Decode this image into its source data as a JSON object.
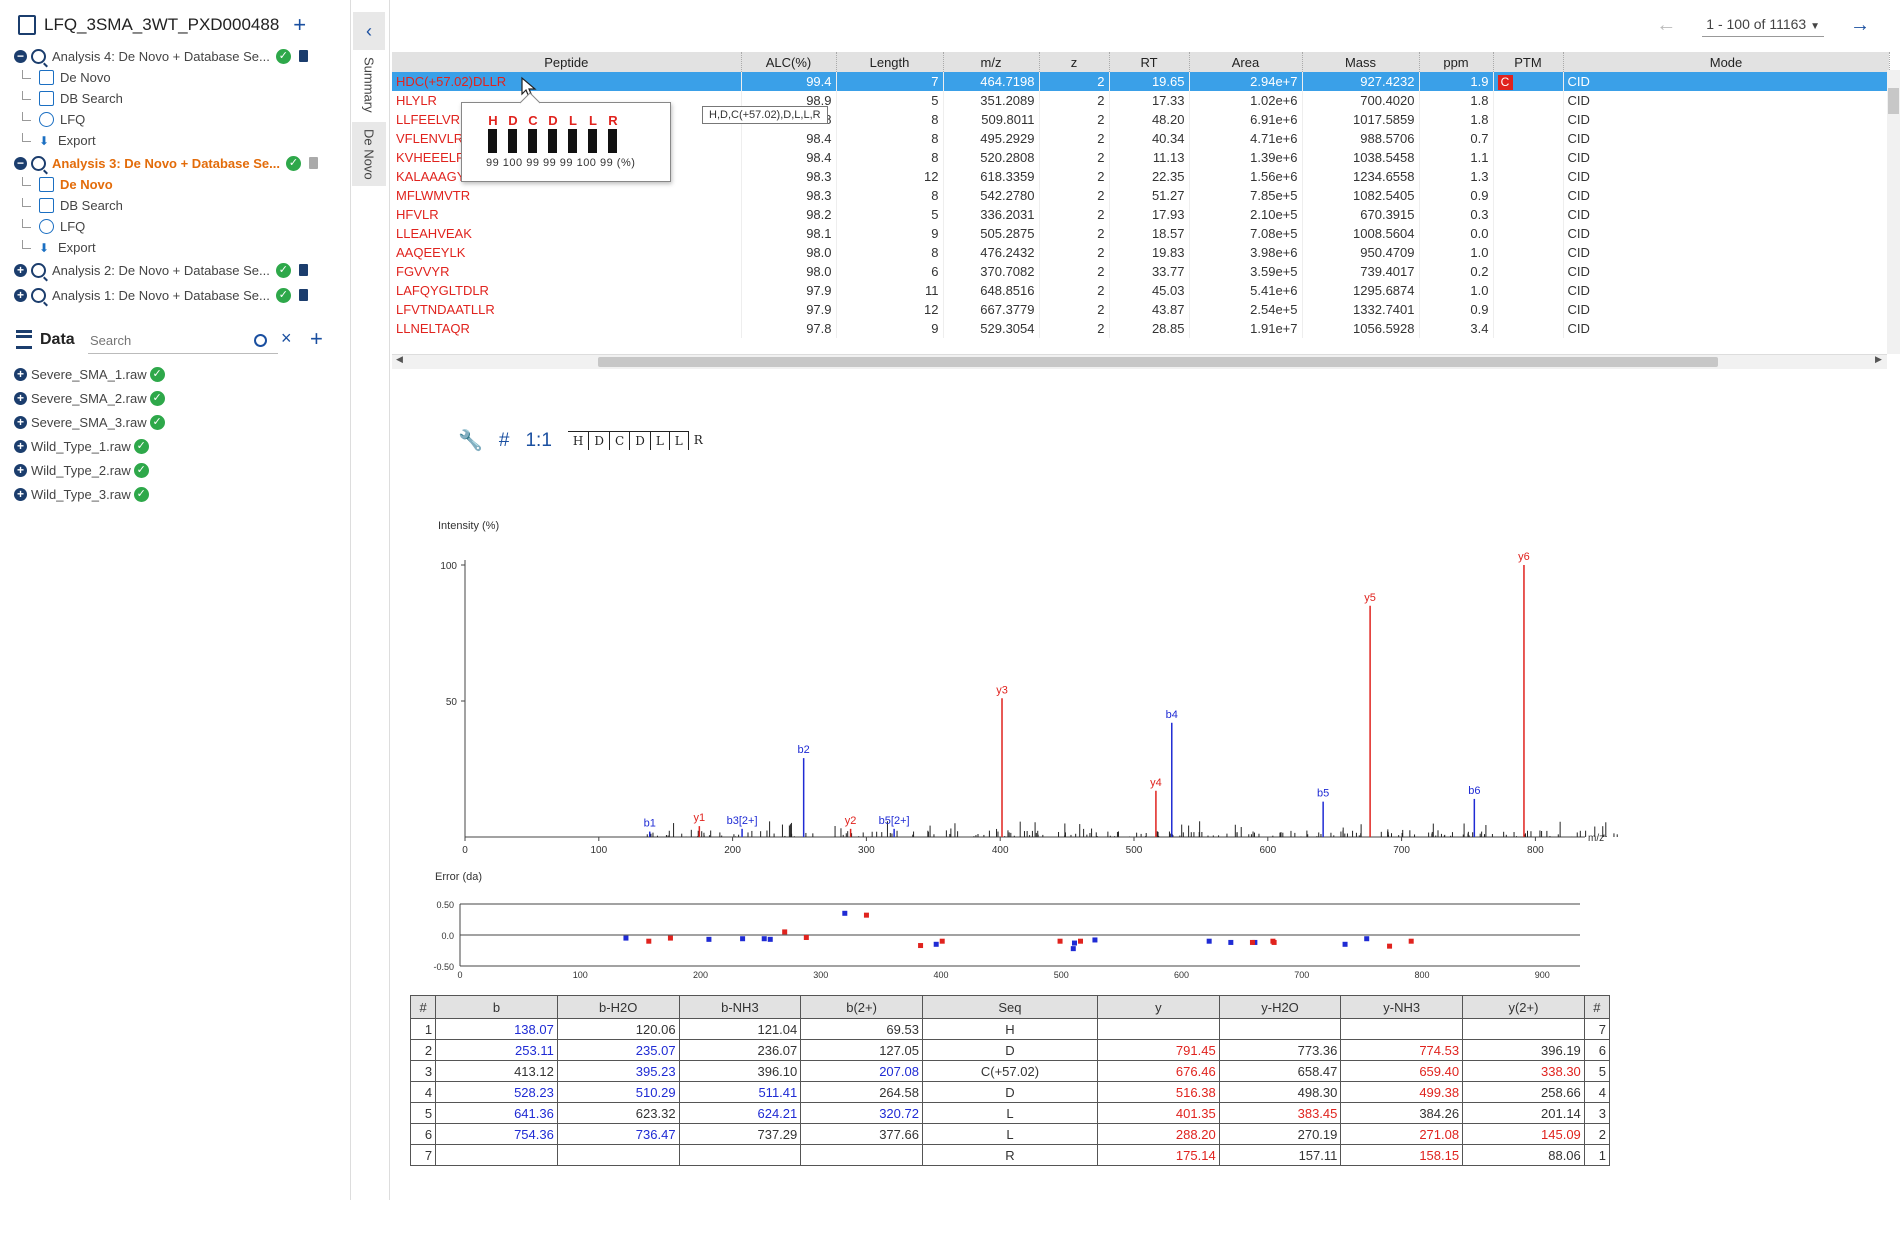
{
  "project": {
    "title": "LFQ_3SMA_3WT_PXD000488"
  },
  "analyses": [
    {
      "label": "Analysis 4: De Novo + Database Se...",
      "expanded": true,
      "active": false,
      "children": [
        "De Novo",
        "DB Search",
        "LFQ",
        "Export"
      ]
    },
    {
      "label": "Analysis 3: De Novo + Database Se...",
      "expanded": true,
      "active": true,
      "children": [
        "De Novo",
        "DB Search",
        "LFQ",
        "Export"
      ]
    },
    {
      "label": "Analysis 2: De Novo + Database Se...",
      "expanded": false,
      "active": false,
      "children": []
    },
    {
      "label": "Analysis 1: De Novo + Database Se...",
      "expanded": false,
      "active": false,
      "children": []
    }
  ],
  "data_panel": {
    "title": "Data",
    "search_placeholder": "Search",
    "files": [
      "Severe_SMA_1.raw",
      "Severe_SMA_2.raw",
      "Severe_SMA_3.raw",
      "Wild_Type_1.raw",
      "Wild_Type_2.raw",
      "Wild_Type_3.raw"
    ]
  },
  "side_tabs": [
    "Summary",
    "De Novo"
  ],
  "pager": {
    "range": "1 - 100 of 11163"
  },
  "peptide_table": {
    "columns": [
      "Peptide",
      "ALC(%)",
      "Length",
      "m/z",
      "z",
      "RT",
      "Area",
      "Mass",
      "ppm",
      "PTM",
      "Mode"
    ],
    "rows": [
      [
        "HDC(+57.02)DLLR",
        "99.4",
        "7",
        "464.7198",
        "2",
        "19.65",
        "2.94e+7",
        "927.4232",
        "1.9",
        "C",
        "CID"
      ],
      [
        "HLYLR",
        "98.9",
        "5",
        "351.2089",
        "2",
        "17.33",
        "1.02e+6",
        "700.4020",
        "1.8",
        "",
        "CID"
      ],
      [
        "LLFEELVR",
        "98.8",
        "8",
        "509.8011",
        "2",
        "48.20",
        "6.91e+6",
        "1017.5859",
        "1.8",
        "",
        "CID"
      ],
      [
        "VFLENVLR",
        "98.4",
        "8",
        "495.2929",
        "2",
        "40.34",
        "4.71e+6",
        "988.5706",
        "0.7",
        "",
        "CID"
      ],
      [
        "KVHEEELR",
        "98.4",
        "8",
        "520.2808",
        "2",
        "11.13",
        "1.39e+6",
        "1038.5458",
        "1.1",
        "",
        "CID"
      ],
      [
        "KALAAAGYDVEK",
        "98.3",
        "12",
        "618.3359",
        "2",
        "22.35",
        "1.56e+6",
        "1234.6558",
        "1.3",
        "",
        "CID"
      ],
      [
        "MFLWMVTR",
        "98.3",
        "8",
        "542.2780",
        "2",
        "51.27",
        "7.85e+5",
        "1082.5405",
        "0.9",
        "",
        "CID"
      ],
      [
        "HFVLR",
        "98.2",
        "5",
        "336.2031",
        "2",
        "17.93",
        "2.10e+5",
        "670.3915",
        "0.3",
        "",
        "CID"
      ],
      [
        "LLEAHVEAK",
        "98.1",
        "9",
        "505.2875",
        "2",
        "18.57",
        "7.08e+5",
        "1008.5604",
        "0.0",
        "",
        "CID"
      ],
      [
        "AAQEEYLK",
        "98.0",
        "8",
        "476.2432",
        "2",
        "19.83",
        "3.98e+6",
        "950.4709",
        "1.0",
        "",
        "CID"
      ],
      [
        "FGVVYR",
        "98.0",
        "6",
        "370.7082",
        "2",
        "33.77",
        "3.59e+5",
        "739.4017",
        "0.2",
        "",
        "CID"
      ],
      [
        "LAFQYGLTDLR",
        "97.9",
        "11",
        "648.8516",
        "2",
        "45.03",
        "5.41e+6",
        "1295.6874",
        "1.0",
        "",
        "CID"
      ],
      [
        "LFVTNDAATLLR",
        "97.9",
        "12",
        "667.3779",
        "2",
        "43.87",
        "2.54e+5",
        "1332.7401",
        "0.9",
        "",
        "CID"
      ],
      [
        "LLNELTAQR",
        "97.8",
        "9",
        "529.3054",
        "2",
        "28.85",
        "1.91e+7",
        "1056.5928",
        "3.4",
        "",
        "CID"
      ]
    ]
  },
  "popover": {
    "letters": [
      "H",
      "D",
      "C",
      "D",
      "L",
      "L",
      "R"
    ],
    "scores": "99 100 99 99 99 100 99 (%)",
    "tooltip": "H,D,C(+57.02),D,L,L,R"
  },
  "seq_toolbar": {
    "hash": "#",
    "ratio": "1:1",
    "letters": [
      "H",
      "D",
      "C",
      "D",
      "L",
      "L",
      "R"
    ]
  },
  "colors": {
    "b_ion": "#1f2bd4",
    "y_ion": "#e0231e",
    "selected_row": "#3aa0e8",
    "active": "#e36c0a"
  },
  "chart_data": [
    {
      "type": "bar",
      "ylabel": "Intensity (%)",
      "xlabel": "m/z",
      "xlim": [
        0,
        950
      ],
      "ylim": [
        0,
        100
      ],
      "xticks": [
        0,
        100,
        200,
        300,
        400,
        500,
        600,
        700,
        800,
        900
      ],
      "yticks": [
        50,
        100
      ],
      "series": [
        {
          "name": "b",
          "x": [
            138.07,
            253.11,
            528.23,
            641.36,
            754.36
          ],
          "values": [
            2,
            29,
            42,
            13,
            14
          ],
          "labels": [
            "b1",
            "b2",
            "b4",
            "b5",
            "b6"
          ]
        },
        {
          "name": "b(2+)",
          "x": [
            207.08,
            320.72
          ],
          "values": [
            3,
            3
          ],
          "labels": [
            "b3[2+]",
            "b5[2+]"
          ]
        },
        {
          "name": "y",
          "x": [
            175.14,
            288.2,
            401.35,
            516.38,
            676.46,
            791.45
          ],
          "values": [
            4,
            3,
            51,
            17,
            85,
            100
          ],
          "labels": [
            "y1",
            "y2",
            "y3",
            "y4",
            "y5",
            "y6"
          ]
        }
      ]
    },
    {
      "type": "scatter",
      "ylabel": "Error (da)",
      "xlim": [
        0,
        950
      ],
      "ylim": [
        -0.5,
        0.5
      ],
      "xticks": [
        0,
        100,
        200,
        300,
        400,
        500,
        600,
        700,
        800,
        900
      ],
      "yticks": [
        "0.50",
        "0.0",
        "-0.50"
      ],
      "series": [
        {
          "name": "b",
          "x": [
            138,
            207,
            253,
            235,
            258,
            320,
            396,
            511,
            510,
            528,
            623,
            641,
            661,
            736,
            754
          ],
          "values": [
            -0.05,
            -0.07,
            -0.06,
            -0.06,
            -0.07,
            0.35,
            -0.15,
            -0.13,
            -0.22,
            -0.08,
            -0.1,
            -0.12,
            -0.12,
            -0.15,
            -0.06
          ]
        },
        {
          "name": "y",
          "x": [
            157,
            175,
            270,
            288,
            338,
            383,
            401,
            499,
            516,
            659,
            676,
            677,
            773,
            791
          ],
          "values": [
            -0.1,
            -0.05,
            0.05,
            -0.04,
            0.32,
            -0.17,
            -0.1,
            -0.1,
            -0.1,
            -0.12,
            -0.1,
            -0.12,
            -0.18,
            -0.1
          ]
        }
      ]
    }
  ],
  "fragment_table": {
    "columns": [
      "#",
      "b",
      "b-H2O",
      "b-NH3",
      "b(2+)",
      "Seq",
      "y",
      "y-H2O",
      "y-NH3",
      "y(2+)",
      "#"
    ],
    "rows": [
      [
        "1",
        "138.07",
        "120.06",
        "121.04",
        "69.53",
        "H",
        "",
        "",
        "",
        "",
        "7"
      ],
      [
        "2",
        "253.11",
        "235.07",
        "236.07",
        "127.05",
        "D",
        "791.45",
        "773.36",
        "774.53",
        "396.19",
        "6"
      ],
      [
        "3",
        "413.12",
        "395.23",
        "396.10",
        "207.08",
        "C(+57.02)",
        "676.46",
        "658.47",
        "659.40",
        "338.30",
        "5"
      ],
      [
        "4",
        "528.23",
        "510.29",
        "511.41",
        "264.58",
        "D",
        "516.38",
        "498.30",
        "499.38",
        "258.66",
        "4"
      ],
      [
        "5",
        "641.36",
        "623.32",
        "624.21",
        "320.72",
        "L",
        "401.35",
        "383.45",
        "384.26",
        "201.14",
        "3"
      ],
      [
        "6",
        "754.36",
        "736.47",
        "737.29",
        "377.66",
        "L",
        "288.20",
        "270.19",
        "271.08",
        "145.09",
        "2"
      ],
      [
        "7",
        "",
        "",
        "",
        "",
        "R",
        "175.14",
        "157.11",
        "158.15",
        "88.06",
        "1"
      ]
    ],
    "highlight": [
      [
        "",
        "b",
        "",
        "",
        "",
        "",
        "r",
        "",
        "r",
        "",
        ""
      ],
      [
        "",
        "b",
        "b",
        "",
        "",
        "",
        "r",
        "",
        "r",
        "",
        ""
      ],
      [
        "",
        "",
        "b",
        "",
        "b",
        "",
        "r",
        "",
        "r",
        "r",
        ""
      ],
      [
        "",
        "b",
        "b",
        "b",
        "",
        "",
        "r",
        "",
        "r",
        "",
        ""
      ],
      [
        "",
        "b",
        "",
        "b",
        "b",
        "",
        "r",
        "r",
        "",
        "",
        ""
      ],
      [
        "",
        "b",
        "b",
        "",
        "",
        "",
        "r",
        "",
        "r",
        "r",
        ""
      ],
      [
        "",
        "",
        "",
        "",
        "",
        "",
        "r",
        "",
        "r",
        "",
        ""
      ]
    ]
  }
}
